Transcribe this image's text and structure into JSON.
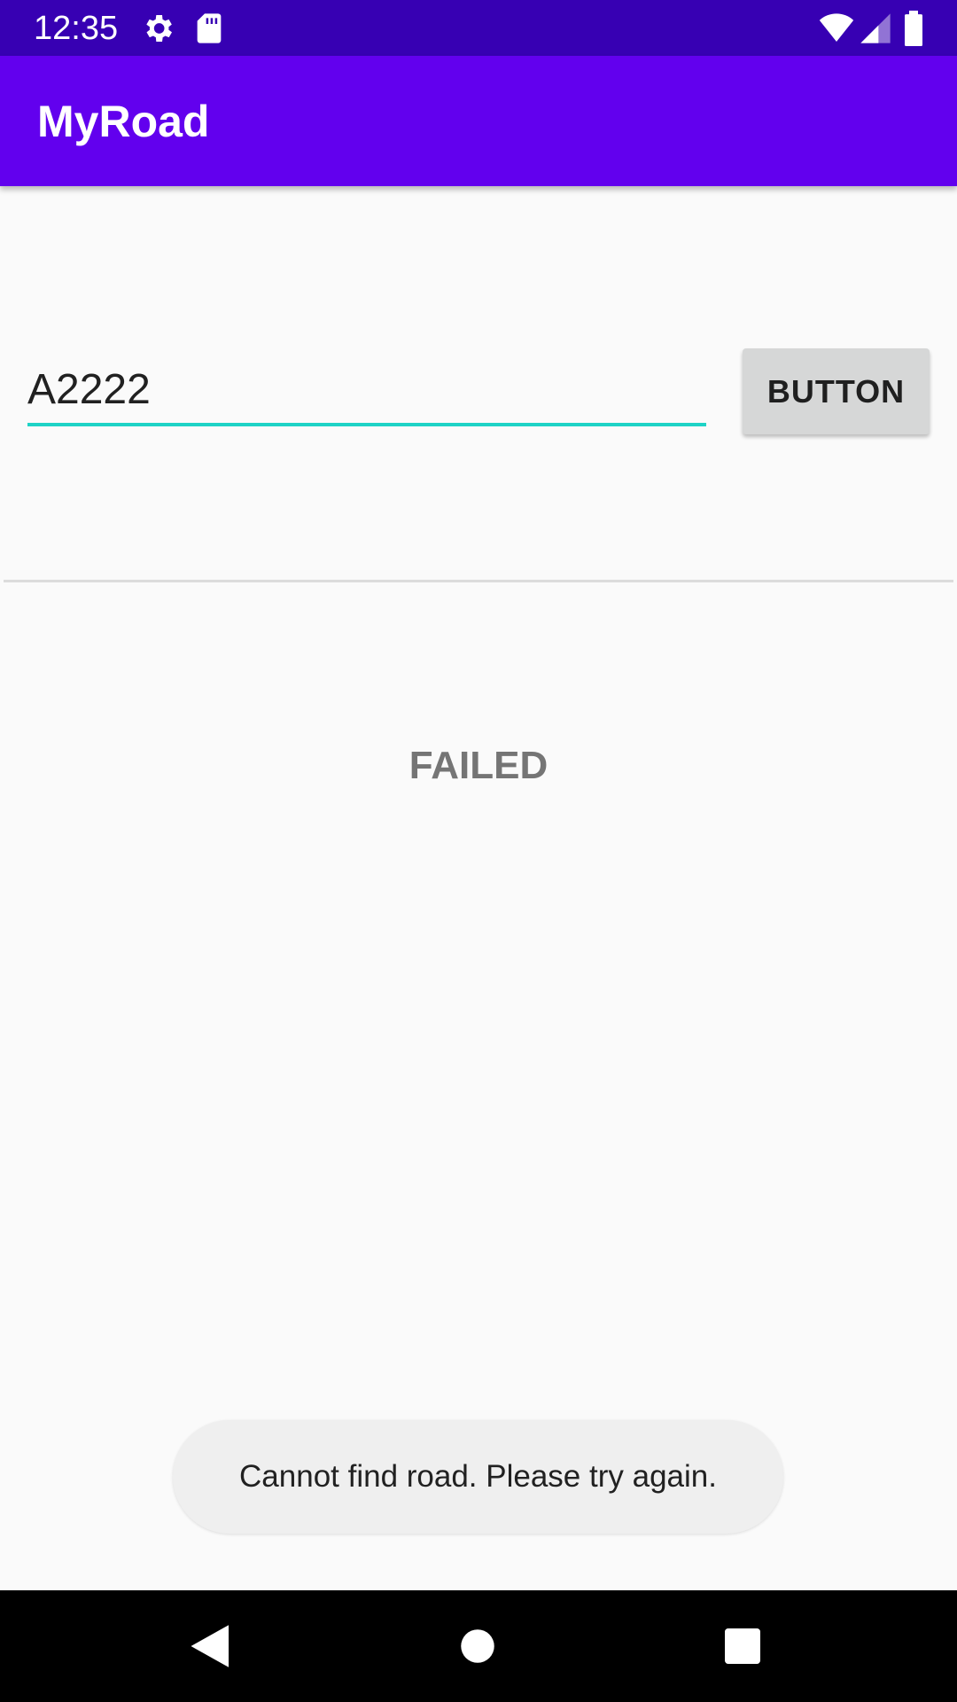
{
  "status_bar": {
    "time": "12:35",
    "icons": [
      "settings-icon",
      "sd-card-icon",
      "wifi-icon",
      "signal-icon",
      "battery-icon"
    ]
  },
  "app_bar": {
    "title": "MyRoad"
  },
  "form": {
    "road_value": "A2222",
    "button_label": "BUTTON"
  },
  "result": {
    "status_text": "FAILED"
  },
  "toast": {
    "message": "Cannot find road. Please try again."
  },
  "nav_bar": {
    "icons": [
      "back-icon",
      "home-icon",
      "recents-icon"
    ]
  },
  "colors": {
    "status_bar": "#3700b3",
    "app_bar": "#6200ee",
    "input_accent": "#1ed3c6",
    "button_bg": "#d6d7d7",
    "result_text": "#757575",
    "toast_bg": "#efefef"
  }
}
